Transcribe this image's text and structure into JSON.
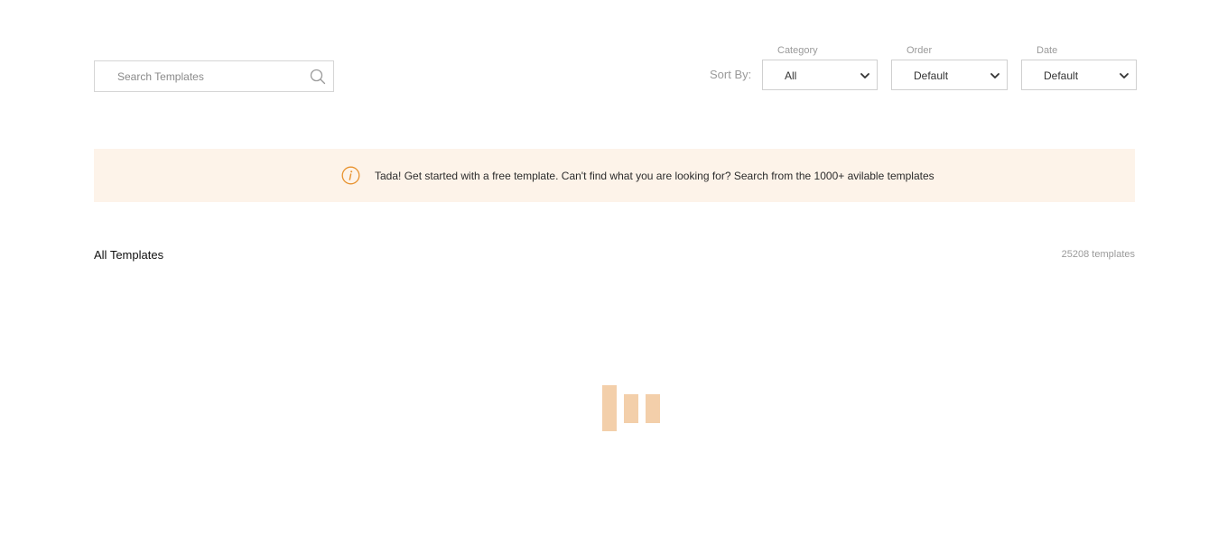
{
  "search": {
    "placeholder": "Search Templates",
    "value": ""
  },
  "sort": {
    "label": "Sort By:",
    "filters": [
      {
        "caption": "Category",
        "selected": "All"
      },
      {
        "caption": "Order",
        "selected": "Default"
      },
      {
        "caption": "Date",
        "selected": "Default"
      }
    ]
  },
  "notice": {
    "icon": "info-icon",
    "text": "Tada! Get started with a free template. Can't find what you are looking for? Search from the 1000+ avilable templates"
  },
  "templates_section": {
    "title": "All Templates",
    "count_text": "25208 templates"
  },
  "colors": {
    "accent": "#e8922e",
    "notice_bg": "#fdf3e9",
    "loader": "#f3cfaa"
  }
}
